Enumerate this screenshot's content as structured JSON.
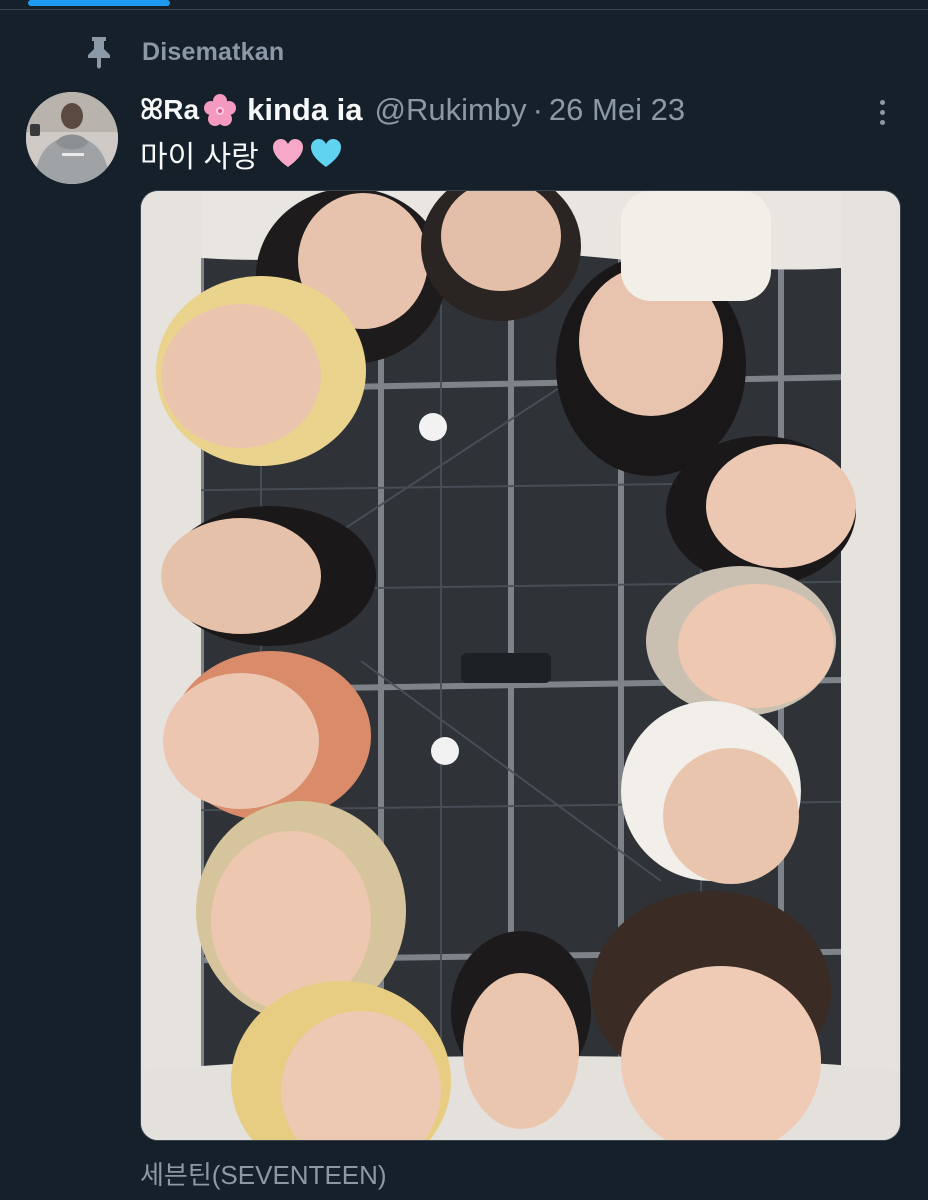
{
  "tabs": {
    "active_indicator_color": "#1d9bf0"
  },
  "pinned": {
    "icon": "pin-icon",
    "label": "Disematkan"
  },
  "tweet": {
    "author": {
      "avatar_icon": "avatar",
      "name_prefix": "ꕤRa",
      "name_flower_icon": "cherry-blossom-icon",
      "name_suffix": "kinda ia",
      "handle": "@Rukimby",
      "separator": "·",
      "timestamp": "26 Mei 23"
    },
    "text": "마이 사랑",
    "text_emojis": [
      "pink-heart-icon",
      "light-blue-heart-icon"
    ],
    "more_icon": "more-vertical-icon",
    "media": {
      "type": "photo",
      "caption": "세븐틴(SEVENTEEN)"
    }
  },
  "colors": {
    "background": "#15202b",
    "primary_text": "#f7f9f9",
    "secondary_text": "#8b98a5",
    "divider": "#38444d"
  }
}
